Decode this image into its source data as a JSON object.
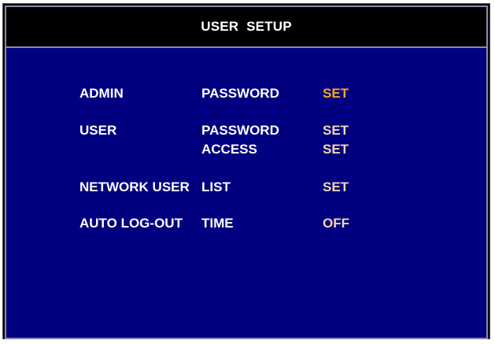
{
  "title": "USER  SETUP",
  "rows": [
    {
      "category": "ADMIN",
      "field": "PASSWORD",
      "value": "SET"
    },
    {
      "category": "USER",
      "field": "PASSWORD",
      "value": "SET"
    },
    {
      "category": "",
      "field": "ACCESS",
      "value": "SET"
    },
    {
      "category": "NETWORK USER",
      "field": "LIST",
      "value": "SET"
    },
    {
      "category": "AUTO LOG-OUT",
      "field": "TIME",
      "value": "OFF"
    }
  ],
  "colors": {
    "panel_bg": "#000080",
    "title_bg": "#000000",
    "label": "#ffffff",
    "selected_value": "#f5a623",
    "value": "#f0d6b0"
  }
}
